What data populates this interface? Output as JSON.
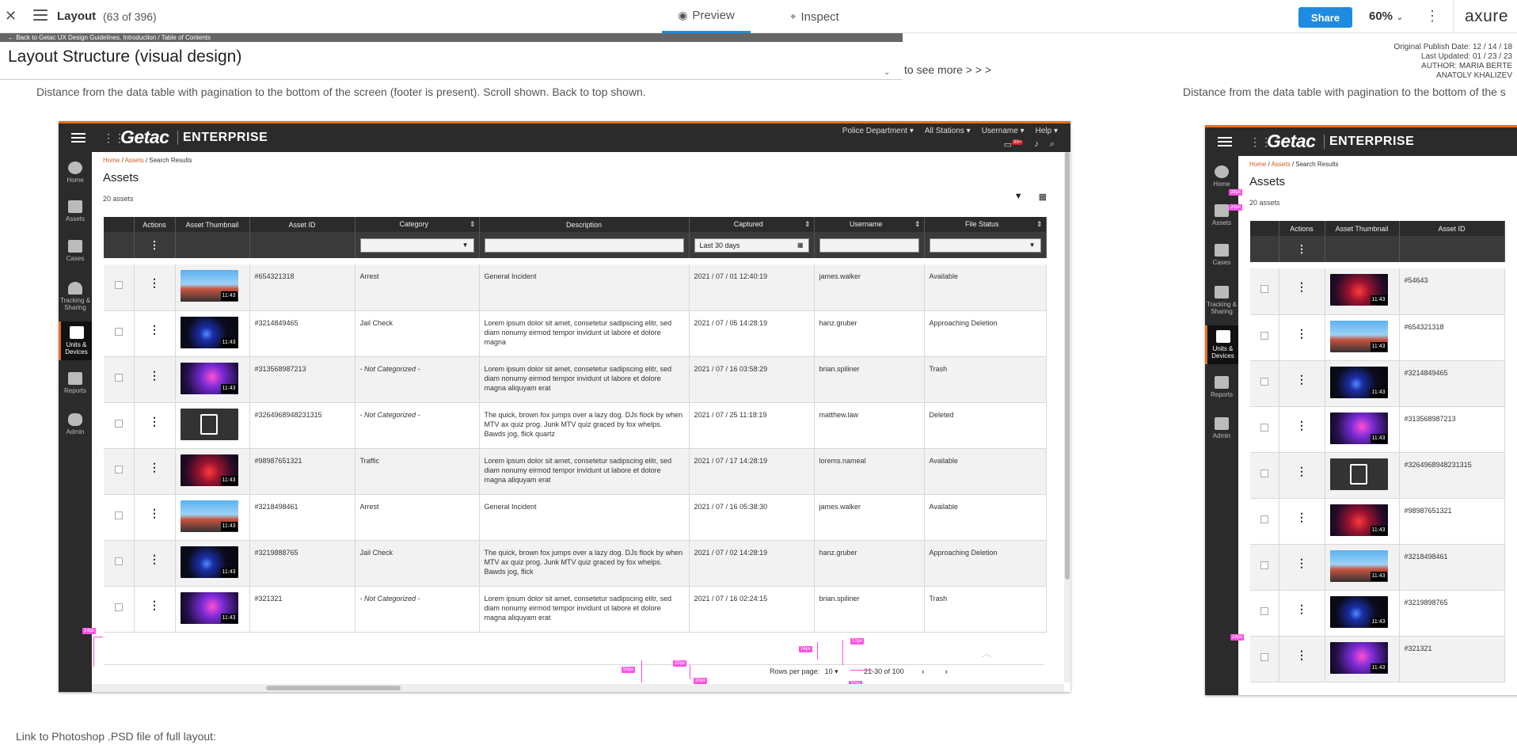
{
  "toolbar": {
    "close_icon": "close-icon",
    "title": "Layout",
    "count": "(63 of 396)",
    "tab_preview": "Preview",
    "tab_inspect": "Inspect",
    "share": "Share",
    "zoom": "60%",
    "logo": "axure"
  },
  "page": {
    "back_link": "← Back to Getac UX Design Guidelines, Introduction / Table of Contents",
    "title": "Layout Structure (visual design)",
    "to_see_more": "to see more  > > >",
    "meta": [
      "Original Publish Date: 12 / 14 / 18",
      "Last Updated:  01 / 23 / 23",
      "AUTHOR: MARIA BERTE",
      "ANATOLY KHALIZEV"
    ],
    "description": "Distance from the data table with pagination to the bottom of the screen (footer is present). Scroll shown. Back to top shown.",
    "description_right": "Distance from the data table with pagination to the bottom of the s",
    "psd_link": "Link to Photoshop .PSD file of full layout:"
  },
  "app": {
    "logo": "Getac",
    "edition": "ENTERPRISE",
    "topnav": [
      "Police Department ▾",
      "All Stations ▾",
      "Username ▾",
      "Help ▾"
    ],
    "badge": "99+",
    "sidebar": [
      {
        "label": "Home",
        "icon": "home-icon"
      },
      {
        "label": "Assets",
        "icon": "assets-icon"
      },
      {
        "label": "Cases",
        "icon": "cases-icon"
      },
      {
        "label": "Tracking & Sharing",
        "icon": "tracking-icon"
      },
      {
        "label": "Units & Devices",
        "icon": "units-icon",
        "active": true
      },
      {
        "label": "Reports",
        "icon": "reports-icon"
      },
      {
        "label": "Admin",
        "icon": "admin-icon"
      }
    ],
    "breadcrumb": [
      "Home",
      "Assets",
      "Search Results"
    ],
    "heading": "Assets",
    "asset_count": "20 assets",
    "columns": [
      "",
      "Actions",
      "Asset Thumbnail",
      "Asset ID",
      "Category",
      "Description",
      "Captured",
      "Username",
      "File Status"
    ],
    "filter_date": "Last 30 days",
    "rows": [
      {
        "thumb": "sky",
        "id": "#654321318",
        "category": "Arrest",
        "desc": "General Incident",
        "captured": "2021 / 07 / 01   12:40:19",
        "user": "james.walker",
        "status": "Available"
      },
      {
        "thumb": "night",
        "id": "#3214849465",
        "category": "Jail Check",
        "desc": "Lorem ipsum dolor sit amet, consetetur sadipscing elitr, sed diam nonumy eirmod tempor invidunt ut labore et dolore magna",
        "captured": "2021 / 07 / 05   14:28:19",
        "user": "hanz.gruber",
        "status": "Approaching Deletion"
      },
      {
        "thumb": "party",
        "id": "#313568987213",
        "category": "- Not Categorized -",
        "desc": "Lorem ipsum dolor sit amet, consetetur sadipscing elitr, sed diam nonumy eirmod tempor invidunt ut labore et dolore magna aliquyam erat",
        "captured": "2021 / 07 / 16   03:58:29",
        "user": "brian.spiliner",
        "status": "Trash"
      },
      {
        "thumb": "file",
        "id": "#3264968948231315",
        "category": "- Not Categorized -",
        "desc": "The quick, brown fox jumps over a lazy dog. DJs flock by when MTV ax quiz prog. Junk MTV quiz graced by fox whelps. Bawds jog, flick quartz",
        "captured": "2021 / 07 / 25   11:18:19",
        "user": "matthew.law",
        "status": "Deleted"
      },
      {
        "thumb": "fire",
        "id": "#98987651321",
        "category": "Traffic",
        "desc": "Lorem ipsum dolor sit amet, consetetur sadipscing elitr, sed diam nonumy eirmod tempor invidunt ut labore et dolore magna aliquyam erat",
        "captured": "2021 / 07 / 17   14:28:19",
        "user": "lorems.nameal",
        "status": "Available"
      },
      {
        "thumb": "sky",
        "id": "#3218498461",
        "category": "Arrest",
        "desc": "General Incident",
        "captured": "2021 / 07 / 16   05:38:30",
        "user": "james.walker",
        "status": "Available"
      },
      {
        "thumb": "night",
        "id": "#3219888765",
        "category": "Jail Check",
        "desc": "The quick, brown fox jumps over a lazy dog. DJs flock by when MTV ax quiz prog. Junk MTV quiz graced by fox whelps. Bawds jog, flick",
        "captured": "2021 / 07 / 02   14:28:19",
        "user": "hanz.gruber",
        "status": "Approaching Deletion"
      },
      {
        "thumb": "party",
        "id": "#321321",
        "category": "- Not Categorized -",
        "desc": "Lorem ipsum dolor sit amet, consetetur sadipscing elitr, sed diam nonumy eirmod tempor invidunt ut labore et dolore magna aliquyam erat",
        "captured": "2021 / 07 / 16   02:24:15",
        "user": "brian.spiliner",
        "status": "Trash"
      }
    ],
    "thumb_duration": "11:43",
    "pager": {
      "rows_label": "Rows per page:",
      "rows_value": "10",
      "range": "21-30 of 100"
    },
    "redlines": [
      "24px",
      "24px",
      "12px",
      "50px",
      "20px",
      "30px",
      "32px"
    ],
    "frame2_rows": [
      {
        "thumb": "fire",
        "id": "#54643"
      },
      {
        "thumb": "sky",
        "id": "#654321318"
      },
      {
        "thumb": "night",
        "id": "#3214849465"
      },
      {
        "thumb": "party",
        "id": "#313568987213"
      },
      {
        "thumb": "file",
        "id": "#3264968948231315"
      },
      {
        "thumb": "fire",
        "id": "#98987651321"
      },
      {
        "thumb": "sky",
        "id": "#3218498461"
      },
      {
        "thumb": "night",
        "id": "#3219898765"
      },
      {
        "thumb": "party",
        "id": "#321321"
      }
    ],
    "frame2_redlines": [
      "28px",
      "20px",
      "24px"
    ]
  }
}
